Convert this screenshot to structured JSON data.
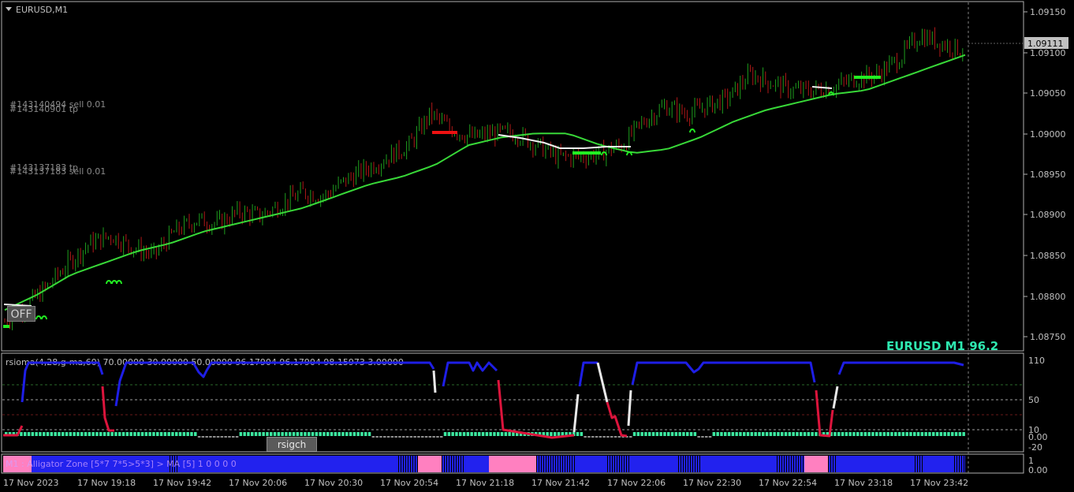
{
  "window": {
    "symbol_title": "EURUSD,M1"
  },
  "main_chart": {
    "price_axis_labels": [
      "1.09150",
      "1.09100",
      "1.09050",
      "1.09000",
      "1.08950",
      "1.08900",
      "1.08850",
      "1.08800",
      "1.08750"
    ],
    "current_price": "1.09111",
    "orders": [
      "#143140494 sell 0.01",
      "#143140901 tp",
      "#143137183 tp",
      "#143137183 sell 0.01"
    ],
    "watermark": "EURUSD M1  96.2",
    "off_button": "OFF"
  },
  "indicator1": {
    "title": "rsioma(4,28,g-ma,60) 70.00000 30.00000 50.00000 96.17904 96.17904 98.15973 3.00000",
    "axis_labels": [
      "110",
      "50",
      "10",
      "0.00",
      "-20"
    ],
    "rsigch_button": "rsigch"
  },
  "indicator2": {
    "title": "M1 : Alligator Zone [5*7 7*5>5*3] > MA [5] 1 0 0 0 0",
    "axis_labels": [
      "1",
      "0.00"
    ]
  },
  "time_axis": {
    "labels": [
      "17 Nov 2023",
      "17 Nov 19:18",
      "17 Nov 19:42",
      "17 Nov 20:06",
      "17 Nov 20:30",
      "17 Nov 20:54",
      "17 Nov 21:18",
      "17 Nov 21:42",
      "17 Nov 22:06",
      "17 Nov 22:30",
      "17 Nov 22:54",
      "17 Nov 23:18",
      "17 Nov 23:42"
    ]
  },
  "colors": {
    "background": "#000000",
    "bull_candle": "#1e9e1e",
    "bear_candle": "#b01818",
    "ma_line": "#38d838",
    "rsi_blue": "#1e1ee6",
    "rsi_red": "#dc143c",
    "rsi_white": "#e8e8e8",
    "histogram_green": "#3ce8a0",
    "zone_blue": "#2222ee",
    "zone_pink": "#ff80c0",
    "watermark": "#2ee8b0"
  },
  "chart_data": {
    "type": "line",
    "title": "EURUSD,M1",
    "ylim": [
      1.0873,
      1.0917
    ],
    "x_tick_labels": [
      "17 Nov 2023",
      "17 Nov 19:18",
      "17 Nov 19:42",
      "17 Nov 20:06",
      "17 Nov 20:30",
      "17 Nov 20:54",
      "17 Nov 21:18",
      "17 Nov 21:42",
      "17 Nov 22:06",
      "17 Nov 22:30",
      "17 Nov 22:54",
      "17 Nov 23:18",
      "17 Nov 23:42"
    ],
    "series": [
      {
        "values": [
          1.08765,
          1.08785,
          1.0881,
          1.0884,
          1.08865,
          1.08875,
          1.0886,
          1.0885,
          1.0888,
          1.08895,
          1.0889,
          1.08905,
          1.089,
          1.08915,
          1.0893,
          1.08925,
          1.08945,
          1.0896,
          1.08975,
          1.0899,
          1.0903,
          1.0901,
          1.09,
          1.09005,
          1.09005,
          1.0899,
          1.08975,
          1.08975,
          1.0898,
          1.0899,
          1.0902,
          1.0904,
          1.0903,
          1.0904,
          1.0905,
          1.0908,
          1.0907,
          1.0906,
          1.0906,
          1.09065,
          1.09075,
          1.0908,
          1.091,
          1.0913,
          1.0912,
          1.09111
        ]
      },
      {
        "values": [
          1.0878,
          1.088,
          1.08825,
          1.0884,
          1.08855,
          1.08865,
          1.0888,
          1.0889,
          1.089,
          1.0891,
          1.08925,
          1.0894,
          1.0895,
          1.08965,
          1.0899,
          1.09,
          1.09005,
          1.09005,
          1.0899,
          1.0898,
          1.08985,
          1.09,
          1.0902,
          1.09035,
          1.09045,
          1.09055,
          1.0906,
          1.09075,
          1.0909,
          1.09105
        ]
      }
    ]
  }
}
